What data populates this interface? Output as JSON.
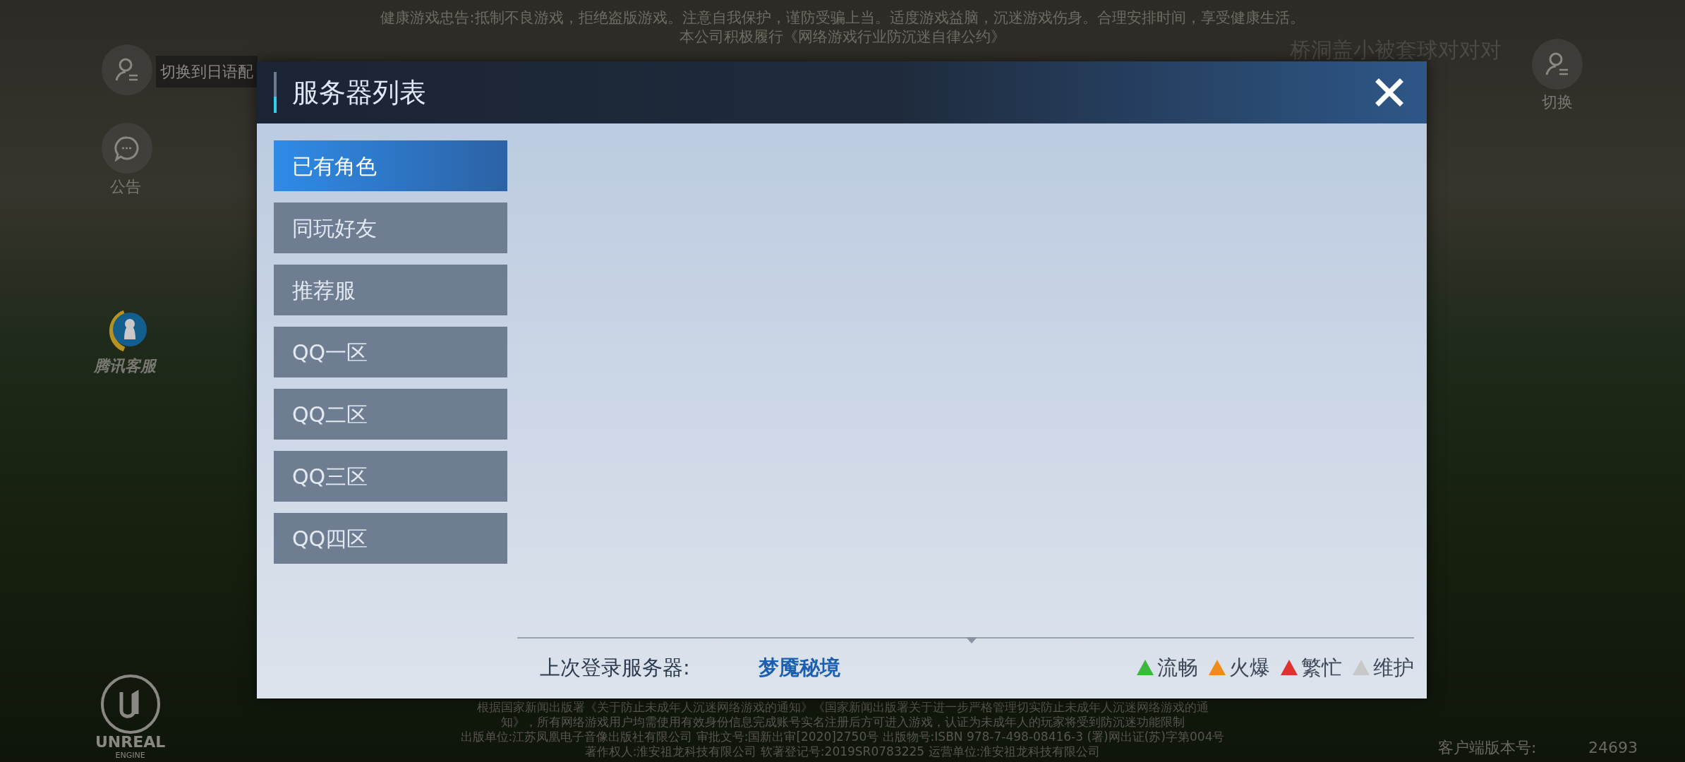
{
  "notice": [
    "健康游戏忠告:抵制不良游戏，拒绝盗版游戏。注意自我保护，谨防受骗上当。适度游戏益脑，沉迷游戏伤身。合理安排时间，享受健康生活。",
    "本公司积极履行《网络游戏行业防沉迷自律公约》"
  ],
  "hud_left": [
    {
      "kind": "voice-switch",
      "label": "切换到日语配"
    },
    {
      "kind": "announcement",
      "label": "公告"
    },
    {
      "kind": "support",
      "label": "腾讯客服"
    }
  ],
  "hud_right": {
    "player_name": "桥洞盖小被套球对对对",
    "switch_label": "切换"
  },
  "engine_logo": {
    "line1": "UNREAL",
    "line2": "ENGINE"
  },
  "dialog": {
    "title": "服务器列表",
    "tabs": [
      {
        "label": "已有角色",
        "selected": true
      },
      {
        "label": "同玩好友",
        "selected": false
      },
      {
        "label": "推荐服",
        "selected": false
      },
      {
        "label": "QQ一区",
        "selected": false
      },
      {
        "label": "QQ二区",
        "selected": false
      },
      {
        "label": "QQ三区",
        "selected": false
      },
      {
        "label": "QQ四区",
        "selected": false
      }
    ],
    "last_login": {
      "label": "上次登录服务器:",
      "server": "梦魇秘境"
    },
    "legend": [
      {
        "label": "流畅",
        "color": "#3cb83c"
      },
      {
        "label": "火爆",
        "color": "#f08a1c"
      },
      {
        "label": "繁忙",
        "color": "#e03030"
      },
      {
        "label": "维护",
        "color": "#c8c8c8"
      }
    ]
  },
  "footer_notice": [
    "根据国家新闻出版署《关于防止未成年人沉迷网络游戏的通知》《国家新闻出版署关于进一步严格管理切实防止未成年人沉迷网络游戏的通",
    "知》，所有网络游戏用户均需使用有效身份信息完成账号实名注册后方可进入游戏，认证为未成年人的玩家将受到防沉迷功能限制",
    "出版单位:江苏凤凰电子音像出版社有限公司 审批文号:国新出审[2020]2750号 出版物号:ISBN 978-7-498-08416-3 (署)网出证(苏)字第004号",
    "著作权人:淮安祖龙科技有限公司 软著登记号:2019SR0783225 运营单位:淮安祖龙科技有限公司"
  ],
  "client_version": {
    "label": "客户端版本号:",
    "value": "24693"
  }
}
